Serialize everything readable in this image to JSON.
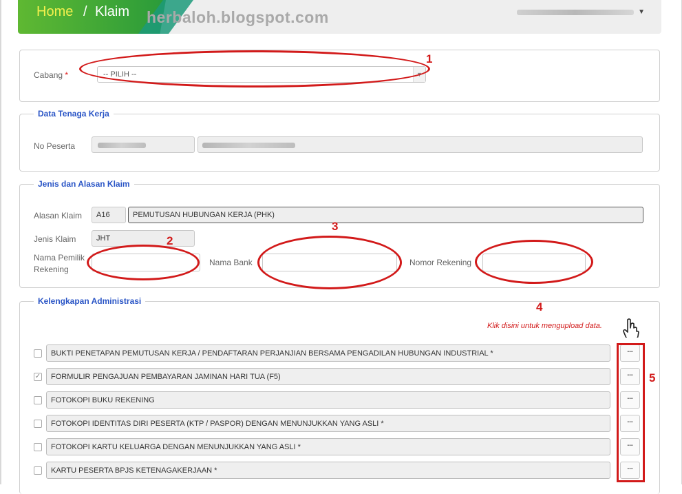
{
  "header": {
    "home": "Home",
    "separator": "/",
    "page": "Klaim",
    "watermark": "herbaloh.blogspot.com"
  },
  "cabang": {
    "label": "Cabang",
    "required_mark": "*",
    "selected": "-- PILIH --"
  },
  "data_tenaga_kerja": {
    "legend": "Data Tenaga Kerja",
    "no_peserta_label": "No Peserta"
  },
  "jenis_alasan": {
    "legend": "Jenis dan Alasan Klaim",
    "alasan_label": "Alasan Klaim",
    "alasan_code": "A16",
    "alasan_text": "PEMUTUSAN HUBUNGAN KERJA (PHK)",
    "jenis_label": "Jenis Klaim",
    "jenis_value": "JHT",
    "nama_pemilik_label_1": "Nama Pemilik",
    "nama_pemilik_label_2": "Rekening",
    "nama_bank_label": "Nama Bank",
    "nomor_rekening_label": "Nomor Rekening"
  },
  "kelengkapan": {
    "legend": "Kelengkapan Administrasi",
    "hint": "Klik disini untuk mengupload data.",
    "upload_label": "...",
    "documents": [
      {
        "label": "BUKTI PENETAPAN PEMUTUSAN KERJA / PENDAFTARAN PERJANJIAN BERSAMA PENGADILAN HUBUNGAN INDUSTRIAL *",
        "checked": false
      },
      {
        "label": "FORMULIR PENGAJUAN PEMBAYARAN JAMINAN HARI TUA (F5)",
        "checked": true
      },
      {
        "label": "FOTOKOPI BUKU REKENING",
        "checked": false
      },
      {
        "label": "FOTOKOPI IDENTITAS DIRI PESERTA (KTP / PASPOR) DENGAN MENUNJUKKAN YANG ASLI *",
        "checked": false
      },
      {
        "label": "FOTOKOPI KARTU KELUARGA DENGAN MENUNJUKKAN YANG ASLI *",
        "checked": false
      },
      {
        "label": "KARTU PESERTA BPJS KETENAGAKERJAAN *",
        "checked": false
      }
    ]
  },
  "annotations": {
    "n1": "1",
    "n2": "2",
    "n3": "3",
    "n4": "4",
    "n5": "5",
    "color": "#d21a1a"
  },
  "colors": {
    "accent_green": "#2a9b3a",
    "home_yellow": "#f3f04d",
    "legend_blue": "#2a55c6"
  }
}
